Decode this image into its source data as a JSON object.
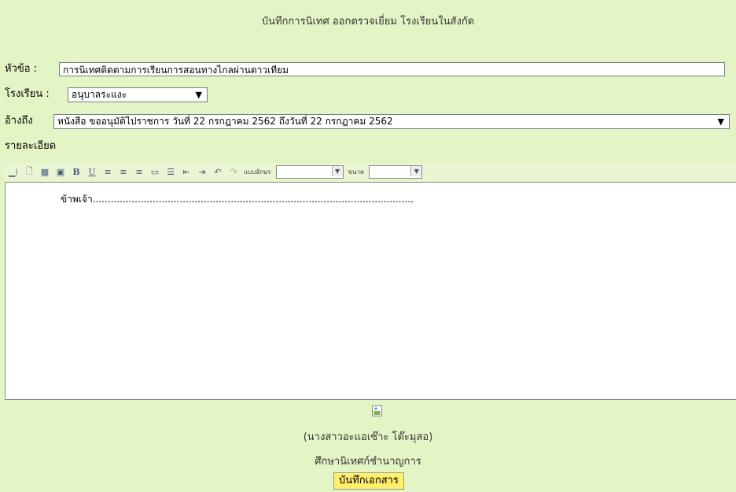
{
  "header": {
    "title": "บันทึกการนิเทศ ออกตรวจเยี่ยม โรงเรียนในสังกัด"
  },
  "form": {
    "topic_label": "หัวข้อ :",
    "topic_value": "การนิเทศติดตามการเรียนการสอนทางไกลผ่านดาวเทียม",
    "school_label": "โรงเรียน :",
    "school_value": "อนุบาลระแงะ",
    "reference_label": "อ้างถึง",
    "reference_value": "หนังสือ ขออนุมัติไปราชการ วันที่ 22 กรกฎาคม 2562 ถึงวันที่ 22 กรกฎาคม 2562",
    "details_label": "รายละเอียด"
  },
  "toolbar": {
    "font_label": "แบบอักษร",
    "size_label": "ขนาด",
    "font_value": "",
    "size_value": ""
  },
  "editor": {
    "content": "ข้าพเจ้า..........................................................................................................."
  },
  "signature": {
    "name": "(นางสาวอะแอเซ๊าะ โต๊ะมุสอ)",
    "position": "ศึกษานิเทศก์ชำนาญการ"
  },
  "actions": {
    "save_label": "บันทึกเอกสาร"
  }
}
